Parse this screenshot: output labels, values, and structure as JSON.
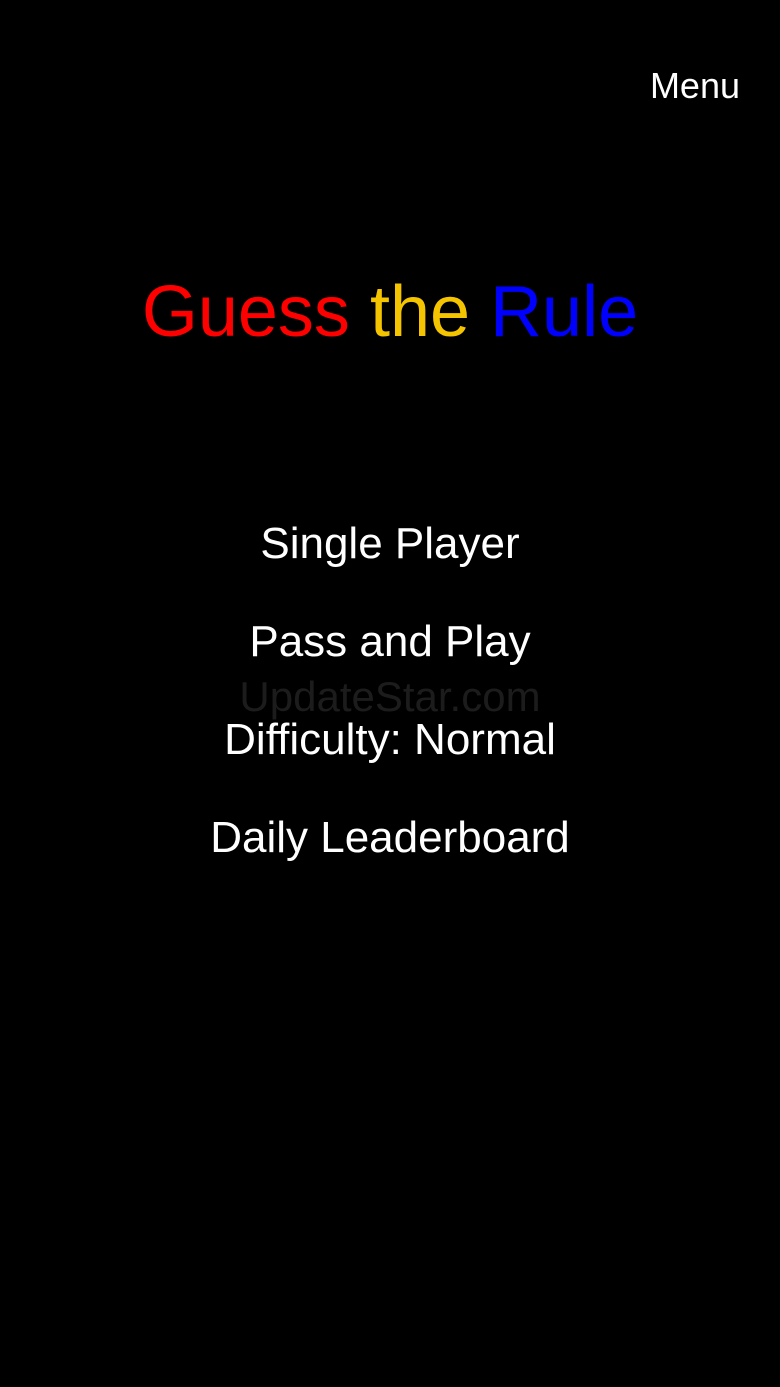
{
  "header": {
    "menu_label": "Menu"
  },
  "title": {
    "words": [
      {
        "text": "Guess",
        "color": "#ff0000"
      },
      {
        "text": "the",
        "color": "#f5c400"
      },
      {
        "text": "Rule",
        "color": "#0000ff"
      }
    ]
  },
  "main_menu": {
    "items": [
      {
        "label": "Single Player"
      },
      {
        "label": "Pass and Play"
      },
      {
        "label": "Difficulty: Normal"
      },
      {
        "label": "Daily Leaderboard"
      }
    ]
  },
  "watermark": {
    "text": "UpdateStar.com"
  },
  "colors": {
    "background": "#000000",
    "text": "#ffffff"
  }
}
